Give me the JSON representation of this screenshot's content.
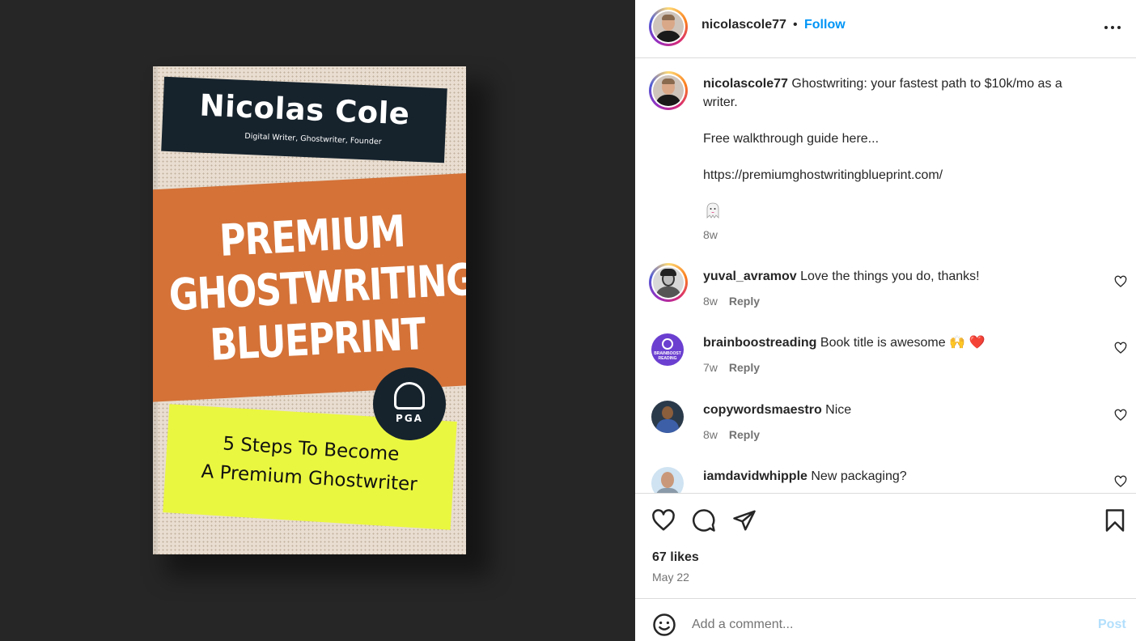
{
  "media": {
    "book": {
      "author": "Nicolas Cole",
      "author_subtitle": "Digital Writer, Ghostwriter, Founder",
      "title_lines": [
        "PREMIUM",
        "GHOSTWRITING",
        "BLUEPRINT"
      ],
      "badge": "PGA",
      "subtitle_lines": [
        "5  Steps To Become",
        "A Premium Ghostwriter"
      ],
      "colors": {
        "navy": "#16232d",
        "orange": "#d47238",
        "yellow": "#eaf740",
        "paper": "#e8ddd0"
      }
    }
  },
  "header": {
    "username": "nicolascole77",
    "separator": "•",
    "follow_label": "Follow",
    "more_icon": "more-horizontal-icon"
  },
  "caption": {
    "username": "nicolascole77",
    "text_line1": "Ghostwriting: your fastest path to $10k/mo as a",
    "text_line2": "writer.",
    "paragraph2": "Free walkthrough guide here...",
    "link": "https://premiumghostwritingblueprint.com/",
    "emoji": "ghost-emoji",
    "time": "8w"
  },
  "comments": [
    {
      "username": "yuval_avramov",
      "text": "Love the things you do, thanks!",
      "time": "8w",
      "reply": "Reply"
    },
    {
      "username": "brainboostreading",
      "text": "Book title is awesome 🙌 ❤️",
      "time": "7w",
      "reply": "Reply",
      "avatar_text": "BRAINBOOST READING"
    },
    {
      "username": "copywordsmaestro",
      "text": "Nice",
      "time": "8w",
      "reply": "Reply"
    },
    {
      "username": "iamdavidwhipple",
      "text": "New packaging?"
    }
  ],
  "actions": {
    "likes": "67 likes",
    "date": "May 22",
    "icons": [
      "heart-icon",
      "comment-icon",
      "share-icon",
      "bookmark-icon"
    ]
  },
  "add_comment": {
    "placeholder": "Add a comment...",
    "post_label": "Post",
    "emoji_icon": "smiley-icon"
  },
  "colors": {
    "accent": "#0095f6",
    "text": "#262626",
    "muted": "#737373",
    "post_disabled": "#b2dffc",
    "media_bg": "#262626"
  }
}
